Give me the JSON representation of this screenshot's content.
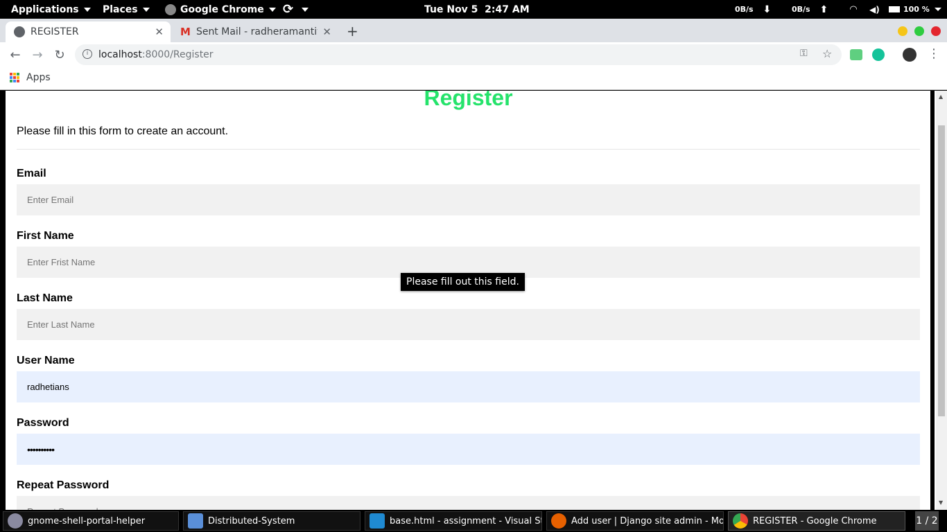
{
  "topbar": {
    "applications": "Applications",
    "places": "Places",
    "app_name": "Google Chrome",
    "clock": "Tue Nov 5  2:47 AM",
    "net_down": "0B/s",
    "net_up": "0B/s",
    "battery": "100 %"
  },
  "browser": {
    "tabs": [
      {
        "title": "REGISTER",
        "icon": "globe-icon"
      },
      {
        "title": "Sent Mail - radheramantiv",
        "icon": "gmail-icon"
      }
    ],
    "address": {
      "host": "localhost",
      "path": ":8000/Register"
    },
    "bookmarks": {
      "apps_label": "Apps"
    }
  },
  "page": {
    "title": "Register",
    "intro": "Please fill in this form to create an account.",
    "fields": [
      {
        "label": "Email",
        "placeholder": "Enter Email",
        "value": ""
      },
      {
        "label": "First Name",
        "placeholder": "Enter Frist Name",
        "value": ""
      },
      {
        "label": "Last Name",
        "placeholder": "Enter Last Name",
        "value": ""
      },
      {
        "label": "User Name",
        "placeholder": "",
        "value": "radhetians"
      },
      {
        "label": "Password",
        "placeholder": "",
        "value": "••••••••••"
      },
      {
        "label": "Repeat Password",
        "placeholder": "Repeat Password",
        "value": ""
      }
    ],
    "validation_tooltip": "Please fill out this field."
  },
  "taskbar": {
    "items": [
      {
        "title": "gnome-shell-portal-helper",
        "icon": "gnome-icon"
      },
      {
        "title": "Distributed-System",
        "icon": "file-manager-icon"
      },
      {
        "title": "base.html - assignment - Visual St...",
        "icon": "vscode-icon"
      },
      {
        "title": "Add user | Django site admin - Mo...",
        "icon": "firefox-icon"
      },
      {
        "title": "REGISTER - Google Chrome",
        "icon": "chrome-icon"
      }
    ],
    "pager": "1 / 2"
  },
  "colors": {
    "title_green": "#25e36b",
    "autofill_bg": "#e8f0fe",
    "field_bg": "#f1f1f1"
  }
}
